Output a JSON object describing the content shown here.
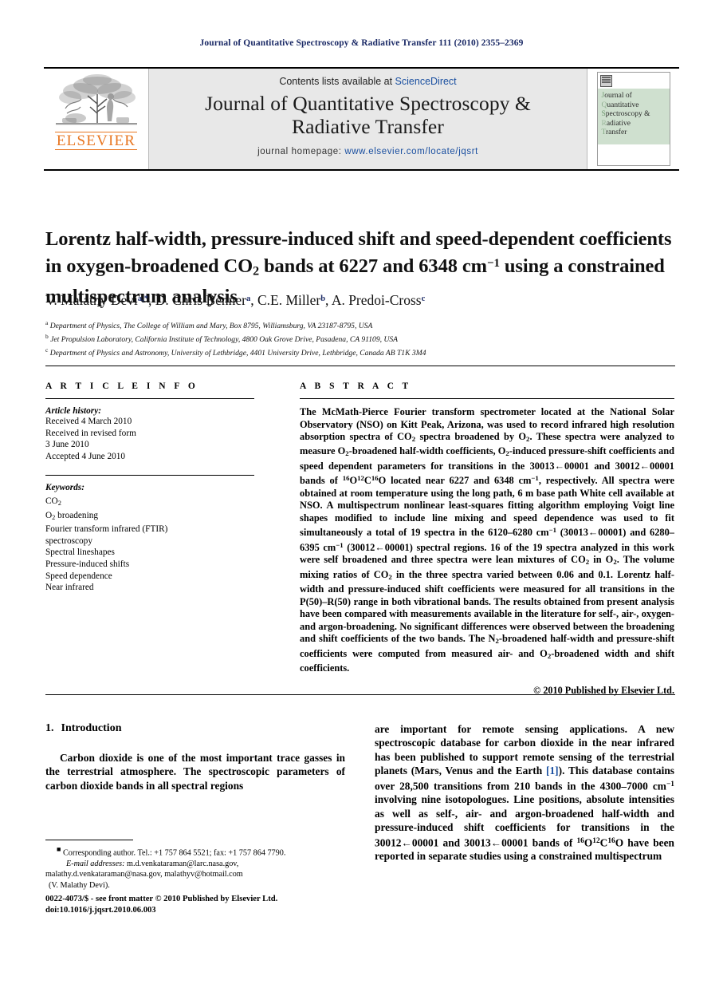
{
  "running_head": "Journal of Quantitative Spectroscopy & Radiative Transfer 111 (2010) 2355–2369",
  "masthead": {
    "contents_prefix": "Contents lists available at ",
    "sciencedirect": "ScienceDirect",
    "journal_name_line1": "Journal of Quantitative Spectroscopy &",
    "journal_name_line2": "Radiative Transfer",
    "homepage_prefix": "journal homepage: ",
    "homepage_url": "www.elsevier.com/locate/jqsrt",
    "publisher_wordmark": "ELSEVIER",
    "cover": {
      "line1": "ournal of",
      "line2": "uantitative",
      "line3": "pectroscopy &",
      "line4": "adiative",
      "line5": "ransfer",
      "cap1": "J",
      "cap2": "Q",
      "cap3": "S",
      "cap4": "R",
      "cap5": "T"
    }
  },
  "article": {
    "title_part1": "Lorentz half-width, pressure-induced shift and speed-dependent coefficients in oxygen-broadened CO",
    "title_sub1": "2",
    "title_part2": " bands at 6227 and 6348 cm",
    "title_sup1": "−1",
    "title_part3": " using a constrained multispectrum analysis",
    "authors_plain": "V. Malathy Devi a,*, D. Chris Benner a, C.E. Miller b, A. Predoi-Cross c",
    "author_1": "V. Malathy Devi",
    "author_1_mark": "a,*",
    "author_2": ", D. Chris Benner",
    "author_2_mark": "a",
    "author_3": ", C.E. Miller",
    "author_3_mark": "b",
    "author_4": ", A. Predoi-Cross",
    "author_4_mark": "c",
    "affiliations": [
      {
        "mark": "a",
        "text": "Department of Physics, The College of William and Mary, Box 8795, Williamsburg, VA 23187-8795, USA"
      },
      {
        "mark": "b",
        "text": "Jet Propulsion Laboratory, California Institute of Technology, 4800 Oak Grove Drive, Pasadena, CA 91109, USA"
      },
      {
        "mark": "c",
        "text": "Department of Physics and Astronomy, University of Lethbridge, 4401 University Drive, Lethbridge, Canada AB T1K 3M4"
      }
    ]
  },
  "article_info": {
    "heading": "A R T I C L E   I N F O",
    "history_label": "Article history:",
    "history_lines": [
      "Received 4 March 2010",
      "Received in revised form",
      "3 June 2010",
      "Accepted 4 June 2010"
    ],
    "keywords_label": "Keywords:",
    "keywords": [
      "CO2",
      "O2 broadening",
      "Fourier transform infrared (FTIR)",
      "spectroscopy",
      "Spectral lineshapes",
      "Pressure-induced shifts",
      "Speed dependence",
      "Near infrared"
    ]
  },
  "abstract": {
    "heading": "A B S T R A C T",
    "text": "The McMath-Pierce Fourier transform spectrometer located at the National Solar Observatory (NSO) on Kitt Peak, Arizona, was used to record infrared high resolution absorption spectra of CO2 spectra broadened by O2. These spectra were analyzed to measure O2-broadened half-width coefficients, O2-induced pressure-shift coefficients and speed dependent parameters for transitions in the 30013←00001 and 30012←00001 bands of 16O12C16O located near 6227 and 6348 cm−1, respectively. All spectra were obtained at room temperature using the long path, 6 m base path White cell available at NSO. A multispectrum nonlinear least-squares fitting algorithm employing Voigt line shapes modified to include line mixing and speed dependence was used to fit simultaneously a total of 19 spectra in the 6120–6280 cm−1 (30013←00001) and 6280–6395 cm−1 (30012←00001) spectral regions. 16 of the 19 spectra analyzed in this work were self broadened and three spectra were lean mixtures of CO2 in O2. The volume mixing ratios of CO2 in the three spectra varied between 0.06 and 0.1. Lorentz half-width and pressure-induced shift coefficients were measured for all transitions in the P(50)–R(50) range in both vibrational bands. The results obtained from present analysis have been compared with measurements available in the literature for self-, air-, oxygen- and argon-broadening. No significant differences were observed between the broadening and shift coefficients of the two bands. The N2-broadened half-width and pressure-shift coefficients were computed from measured air- and O2-broadened width and shift coefficients.",
    "copyright": "© 2010 Published by Elsevier Ltd."
  },
  "body": {
    "section_number": "1.",
    "section_title": "Introduction",
    "left_paragraph": "Carbon dioxide is one of the most important trace gasses in the terrestrial atmosphere. The spectroscopic parameters of carbon dioxide bands in all spectral regions",
    "right_paragraph": "are important for remote sensing applications. A new spectroscopic database for carbon dioxide in the near infrared has been published to support remote sensing of the terrestrial planets (Mars, Venus and the Earth [1]). This database contains over 28,500 transitions from 210 bands in the 4300–7000 cm−1 involving nine isotopologues. Line positions, absolute intensities as well as self-, air- and argon-broadened half-width and pressure-induced shift coefficients for transitions in the 30012←00001 and 30013←00001 bands of 16O12C16O have been reported in separate studies using a constrained multispectrum",
    "reference_marker": "[1]"
  },
  "footnote": {
    "corresponding": "Corresponding author. Tel.: +1 757 864 5521; fax: +1 757 864 7790.",
    "email_label": "E-mail addresses:",
    "email_1": "m.d.venkataraman@larc.nasa.gov,",
    "email_2": "malathy.d.venkataraman@nasa.gov, malathyv@hotmail.com",
    "email_owner": "(V. Malathy Devi)."
  },
  "imprint": {
    "line1": "0022-4073/$ - see front matter © 2010 Published by Elsevier Ltd.",
    "line2": "doi:10.1016/j.jqsrt.2010.06.003"
  },
  "colors": {
    "navy": "#1b2a66",
    "link_blue": "#1a4fa0",
    "elsevier_orange": "#E87722",
    "masthead_gray": "#e8e8e8",
    "cover_green": "#cfe0cf"
  }
}
